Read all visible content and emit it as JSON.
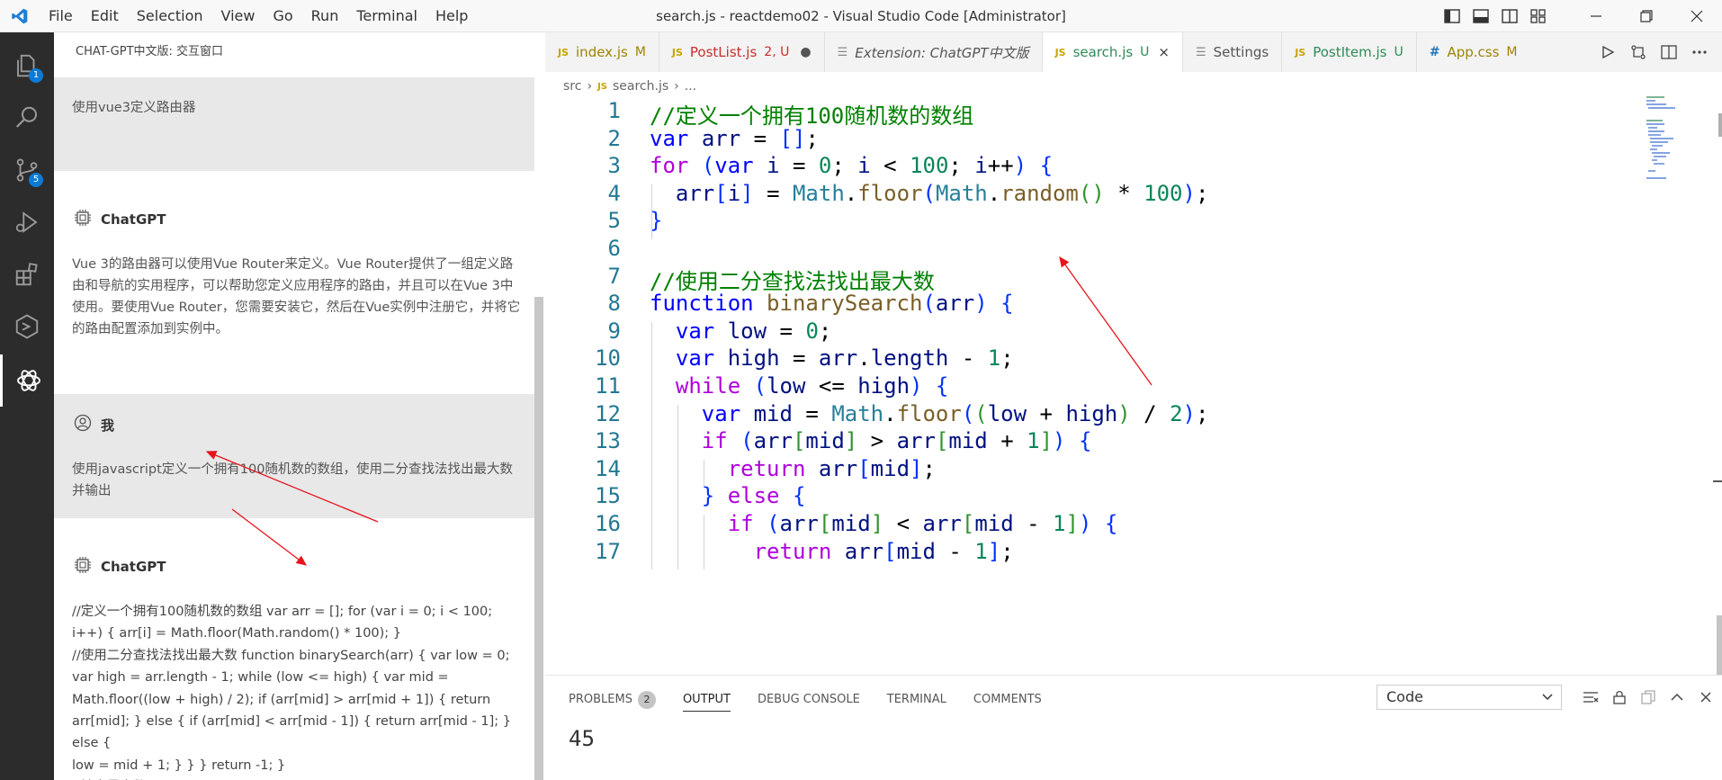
{
  "titlebar": {
    "menu": [
      "File",
      "Edit",
      "Selection",
      "View",
      "Go",
      "Run",
      "Terminal",
      "Help"
    ],
    "title": "search.js - reactdemo02 - Visual Studio Code [Administrator]"
  },
  "activity": {
    "explorer_badge": "1",
    "scm_badge": "5"
  },
  "side": {
    "title": "CHAT-GPT中文版: 交互窗口",
    "messages": [
      {
        "role": "user",
        "text": "使用vue3定义路由器"
      },
      {
        "role": "bot",
        "name": "ChatGPT",
        "text": "Vue 3的路由器可以使用Vue Router来定义。Vue Router提供了一组定义路由和导航的实用程序，可以帮助您定义应用程序的路由，并且可以在Vue 3中使用。要使用Vue Router，您需要安装它，然后在Vue实例中注册它，并将它的路由配置添加到实例中。"
      },
      {
        "role": "user",
        "name": "我",
        "text": "使用javascript定义一个拥有100随机数的数组，使用二分查找法找出最大数并输出"
      },
      {
        "role": "bot",
        "name": "ChatGPT",
        "lines": [
          "//定义一个拥有100随机数的数组 var arr = []; for (var i = 0; i < 100;",
          "i++) { arr[i] = Math.floor(Math.random() * 100); }",
          "//使用二分查找法找出最大数 function binarySearch(arr) { var low = 0;",
          "var high = arr.length - 1; while (low <= high) { var mid =",
          "Math.floor((low + high) / 2); if (arr[mid] > arr[mid + 1]) { return",
          "arr[mid]; } else { if (arr[mid] < arr[mid - 1]) { return arr[mid - 1]; } else {",
          "low = mid + 1; } } } return -1; }",
          "//输出最大数 console.log(binarySearch(arr));"
        ]
      }
    ]
  },
  "tabs": [
    {
      "name": "index.js",
      "status": "M",
      "kind": "js",
      "color": "#9e8400"
    },
    {
      "name": "PostList.js",
      "status": "2, U",
      "kind": "js",
      "color": "#c72e2e",
      "dirty": "●"
    },
    {
      "name": "Extension: ChatGPT中文版",
      "status": "",
      "kind": "ext",
      "color": "#555555",
      "italic": true
    },
    {
      "name": "search.js",
      "status": "U",
      "kind": "js",
      "color": "#2e8b57",
      "active": true,
      "close": "×"
    },
    {
      "name": "Settings",
      "status": "",
      "kind": "settings",
      "color": "#555555"
    },
    {
      "name": "PostItem.js",
      "status": "U",
      "kind": "js",
      "color": "#2e8b57"
    },
    {
      "name": "App.css",
      "status": "M",
      "kind": "css",
      "color": "#9e8400"
    }
  ],
  "breadcrumb": {
    "folder": "src",
    "file": "search.js",
    "more": "..."
  },
  "code_lines": [
    "//定义一个拥有100随机数的数组",
    "var arr = [];",
    "for (var i = 0; i < 100; i++) {",
    "  arr[i] = Math.floor(Math.random() * 100);",
    "}",
    "",
    "//使用二分查找法找出最大数",
    "function binarySearch(arr) {",
    "  var low = 0;",
    "  var high = arr.length - 1;",
    "  while (low <= high) {",
    "    var mid = Math.floor((low + high) / 2);",
    "    if (arr[mid] > arr[mid + 1]) {",
    "      return arr[mid];",
    "    } else {",
    "      if (arr[mid] < arr[mid - 1]) {",
    "        return arr[mid - 1];"
  ],
  "panel": {
    "tabs": [
      "PROBLEMS",
      "OUTPUT",
      "DEBUG CONSOLE",
      "TERMINAL",
      "COMMENTS"
    ],
    "active_tab": "OUTPUT",
    "problems_count": "2",
    "select_value": "Code",
    "output": "45"
  },
  "colors": {
    "accent": "#0a7bd6",
    "annotation": "#e8141c"
  }
}
